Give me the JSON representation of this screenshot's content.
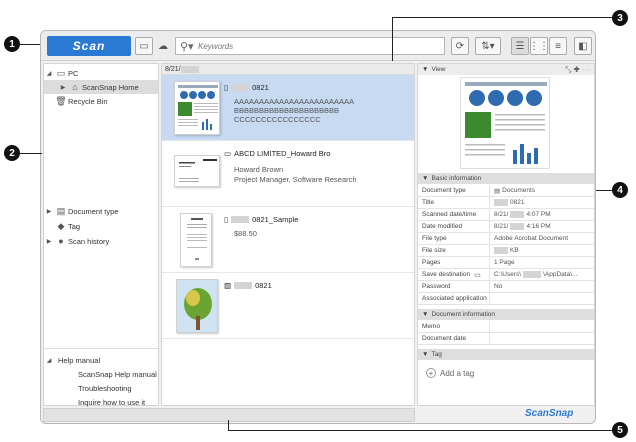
{
  "toolbar": {
    "scan_label": "Scan",
    "search_placeholder": "Keywords",
    "icons": [
      "display-icon",
      "cloud-icon",
      "search-icon",
      "refresh-icon",
      "sort-icon",
      "list-view-icon",
      "grid-view-icon",
      "detail-view-icon",
      "panel-icon"
    ]
  },
  "tree": {
    "pc": "PC",
    "home": "ScanSnap Home",
    "recycle": "Recycle Bin",
    "doc_type": "Document type",
    "tag": "Tag",
    "history": "Scan history",
    "help_manual": "Help manual",
    "help_items": [
      "ScanSnap Help manual",
      "Troubleshooting",
      "Inquire how to use it"
    ]
  },
  "list": {
    "date_header": "8/21/",
    "items": [
      {
        "title": "0821",
        "lines": [
          "AAAAAAAAAAAAAAAAAAAAAAAA",
          "BBBBBBBBBBBBBBBBBBBBB",
          "CCCCCCCCCCCCCCCC"
        ]
      },
      {
        "title": "ABCD LIMITED_Howard Bro",
        "lines": [
          "Howard Brown",
          "Project Manager, Software Research"
        ]
      },
      {
        "title": "0821_Sample",
        "lines": [
          "$88.50"
        ]
      },
      {
        "title": "0821",
        "lines": []
      }
    ]
  },
  "view": {
    "header": "View"
  },
  "basic": {
    "header": "Basic information",
    "rows": [
      {
        "k": "Document type",
        "v": "Documents"
      },
      {
        "k": "Title",
        "v": "0821"
      },
      {
        "k": "Scanned date/time",
        "v": "8/21/",
        "v2": "4:07 PM"
      },
      {
        "k": "Date modified",
        "v": "8/21/",
        "v2": "4:16 PM"
      },
      {
        "k": "File type",
        "v": "Adobe Acrobat Document"
      },
      {
        "k": "File size",
        "v": "KB"
      },
      {
        "k": "Pages",
        "v": "1 Page"
      },
      {
        "k": "Save destination",
        "v": "C:\\Users\\",
        "v2": "\\AppData\\..."
      },
      {
        "k": "Password",
        "v": "No"
      },
      {
        "k": "Associated application",
        "v": ""
      }
    ]
  },
  "docinfo": {
    "header": "Document information",
    "rows": [
      {
        "k": "Memo",
        "v": ""
      },
      {
        "k": "Document date",
        "v": ""
      }
    ]
  },
  "tagsec": {
    "header": "Tag",
    "add": "Add a tag"
  },
  "brand": "ScanSnap",
  "callouts": [
    "1",
    "2",
    "3",
    "4",
    "5"
  ]
}
